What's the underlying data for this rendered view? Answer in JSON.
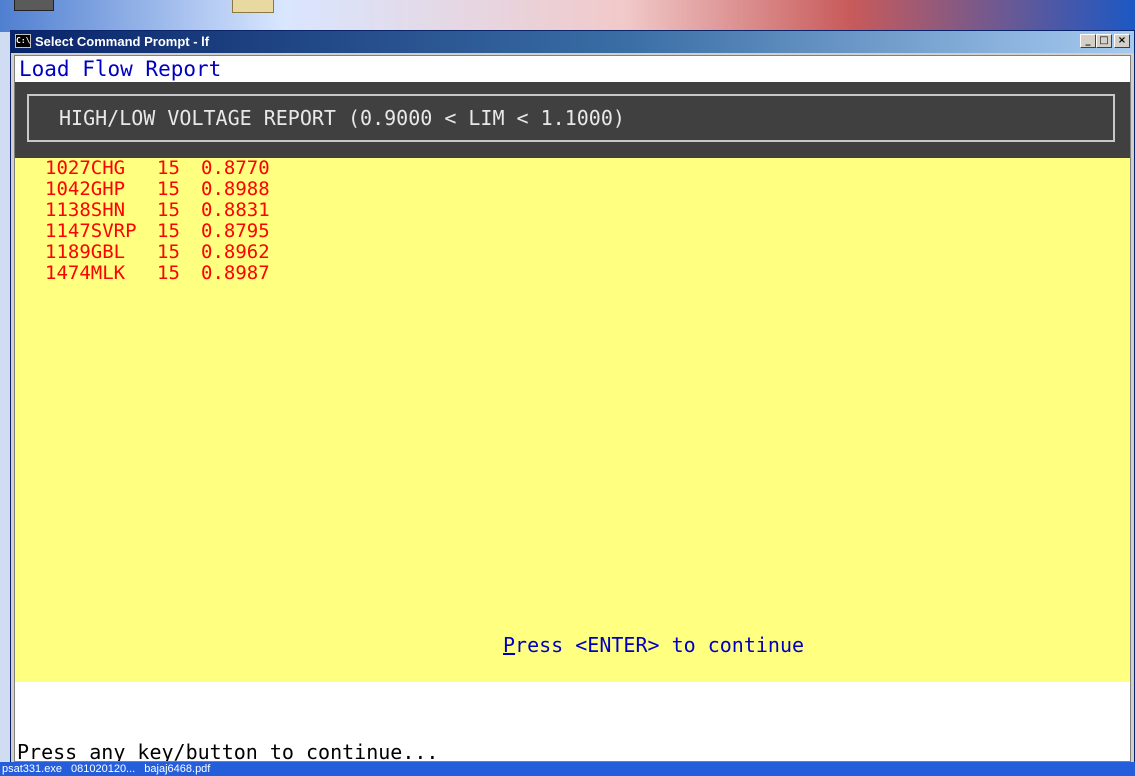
{
  "window": {
    "title": "Select Command Prompt - lf",
    "icon_text": "C:\\",
    "buttons": {
      "minimize": "_",
      "maximize": "□",
      "close": "×"
    }
  },
  "console": {
    "report_title": "Load Flow Report",
    "header": "HIGH/LOW VOLTAGE REPORT (0.9000 < LIM < 1.1000)",
    "rows": [
      {
        "bus": "1027CHG",
        "kv": "15",
        "value": "0.8770"
      },
      {
        "bus": "1042GHP",
        "kv": "15",
        "value": "0.8988"
      },
      {
        "bus": "1138SHN",
        "kv": "15",
        "value": "0.8831"
      },
      {
        "bus": "1147SVRP",
        "kv": "15",
        "value": "0.8795"
      },
      {
        "bus": "1189GBL",
        "kv": "15",
        "value": "0.8962"
      },
      {
        "bus": "1474MLK",
        "kv": "15",
        "value": "0.8987"
      }
    ],
    "press_enter_hot": "P",
    "press_enter_rest": "ress <ENTER> to continue",
    "bottom_prompt": "Press any key/button to continue..."
  },
  "taskbar": {
    "items": [
      "psat331.exe",
      "081020120...",
      "bajaj6468.pdf"
    ]
  },
  "colors": {
    "panel_bg": "#ffff80",
    "value_text": "#ff0000",
    "accent_text": "#0000c0",
    "header_bg": "#404040"
  }
}
